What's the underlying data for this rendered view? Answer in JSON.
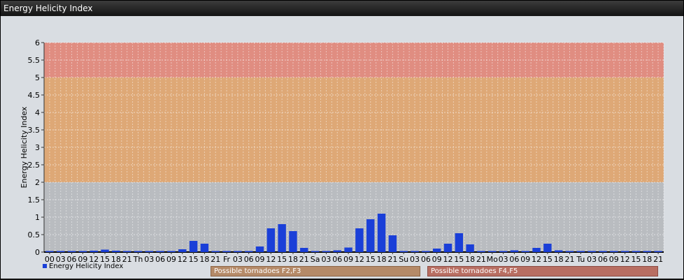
{
  "window": {
    "title": "Energy Helicity Index"
  },
  "chart_data": {
    "type": "bar",
    "title": "",
    "ylabel": "Energy Helicity Index",
    "xlabel": "",
    "ylim": [
      0,
      6
    ],
    "yticks": [
      "0",
      "0.5",
      "1",
      "1.5",
      "2",
      "2.5",
      "3",
      "3.5",
      "4",
      "4.5",
      "5",
      "5.5",
      "6"
    ],
    "grid": true,
    "legend_position": "bottom-left",
    "categories": [
      "00",
      "03",
      "06",
      "09",
      "12",
      "15",
      "18",
      "21",
      "Th",
      "03",
      "06",
      "09",
      "12",
      "15",
      "18",
      "21",
      "Fr",
      "03",
      "06",
      "09",
      "12",
      "15",
      "18",
      "21",
      "Sa",
      "03",
      "06",
      "09",
      "12",
      "15",
      "18",
      "21",
      "Su",
      "03",
      "06",
      "09",
      "12",
      "15",
      "18",
      "21",
      "Mo",
      "03",
      "06",
      "09",
      "12",
      "15",
      "18",
      "21",
      "Tu",
      "03",
      "06",
      "09",
      "12",
      "15",
      "18",
      "21"
    ],
    "series": [
      {
        "name": "Energy Helicity Index",
        "color": "#1a3fd8",
        "values": [
          0.01,
          0.01,
          0.01,
          0.01,
          0.04,
          0.07,
          0.04,
          0.01,
          0.01,
          0.01,
          0.01,
          0.01,
          0.08,
          0.32,
          0.24,
          0.01,
          0.01,
          0.01,
          0.01,
          0.16,
          0.68,
          0.8,
          0.6,
          0.12,
          0.02,
          0.02,
          0.05,
          0.13,
          0.68,
          0.94,
          1.1,
          0.48,
          0.02,
          0.02,
          0.02,
          0.1,
          0.24,
          0.54,
          0.22,
          0.01,
          0.01,
          0.01,
          0.05,
          0.02,
          0.12,
          0.24,
          0.05,
          0.02,
          0.01,
          0.01,
          0.01,
          0.01,
          0.01,
          0.01,
          0.01,
          0.01
        ]
      }
    ],
    "risk_zones": [
      {
        "from": 2,
        "to": 5,
        "color": "#e2a56e",
        "label": "Possible tornadoes F2,F3"
      },
      {
        "from": 5,
        "to": 6,
        "color": "#e4877a",
        "label": "Possible tornadoes F4,F5"
      }
    ]
  }
}
